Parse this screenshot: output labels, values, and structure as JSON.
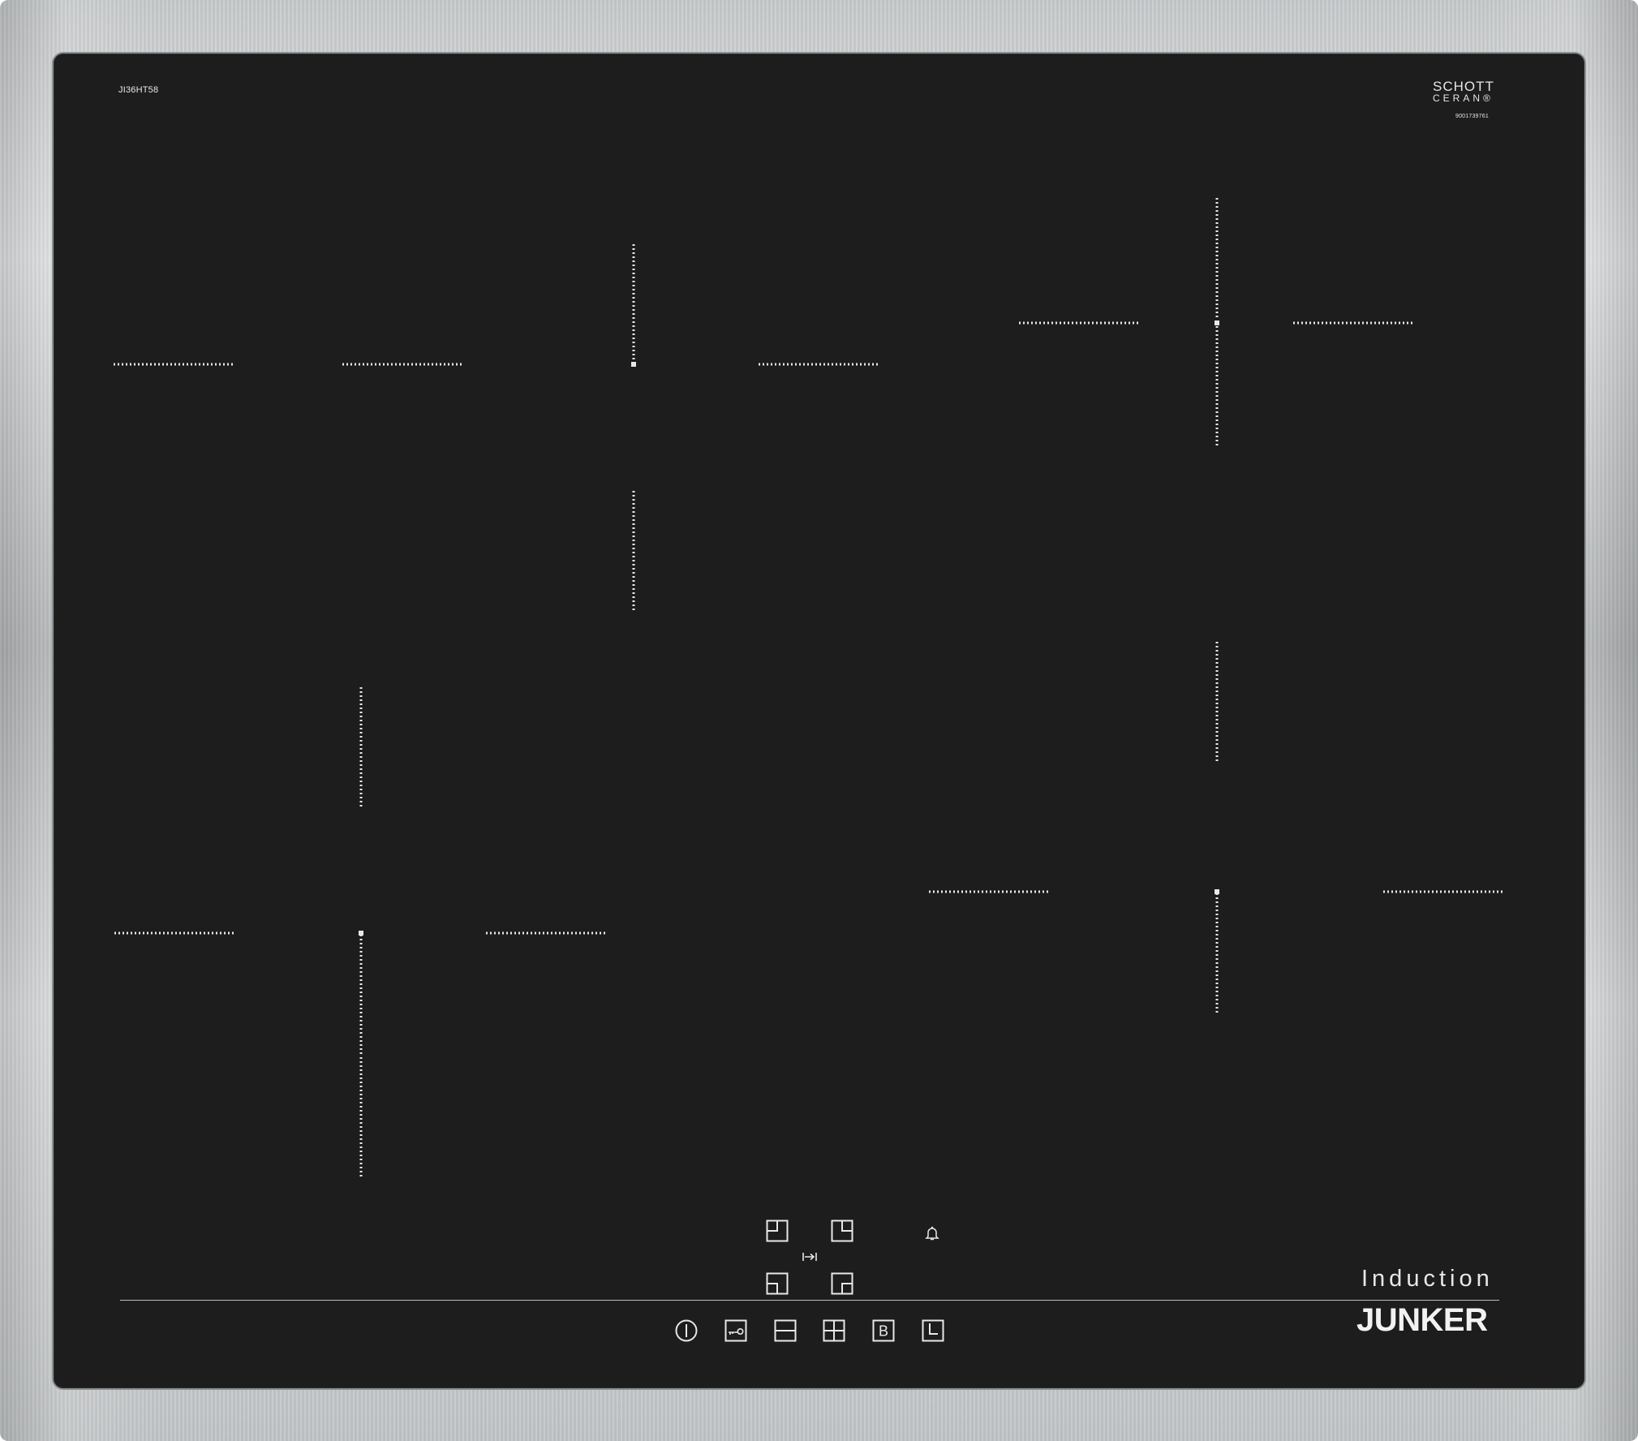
{
  "product": {
    "model_code": "JI36HT58",
    "glass_brand_line1": "SCHOTT",
    "glass_brand_line2": "CERAN®",
    "glass_serial": "9001739761",
    "type_label": "Induction",
    "brand": "JUNKER"
  },
  "colors": {
    "glass": "#1c1d1c",
    "frame": "#c9ccce",
    "markings": "#e8e8e8"
  },
  "controls": {
    "zone_selectors": [
      "zone-front-left-icon",
      "zone-rear-left-icon",
      "zone-rear-right-icon",
      "zone-front-right-icon"
    ],
    "center_icon": "transfer-icon",
    "timer_bell_icon": "bell-icon",
    "bottom_row": [
      "power-icon",
      "child-lock-icon",
      "minus-icon",
      "plus-icon",
      "boost-icon",
      "timer-icon"
    ],
    "boost_letter": "B"
  }
}
